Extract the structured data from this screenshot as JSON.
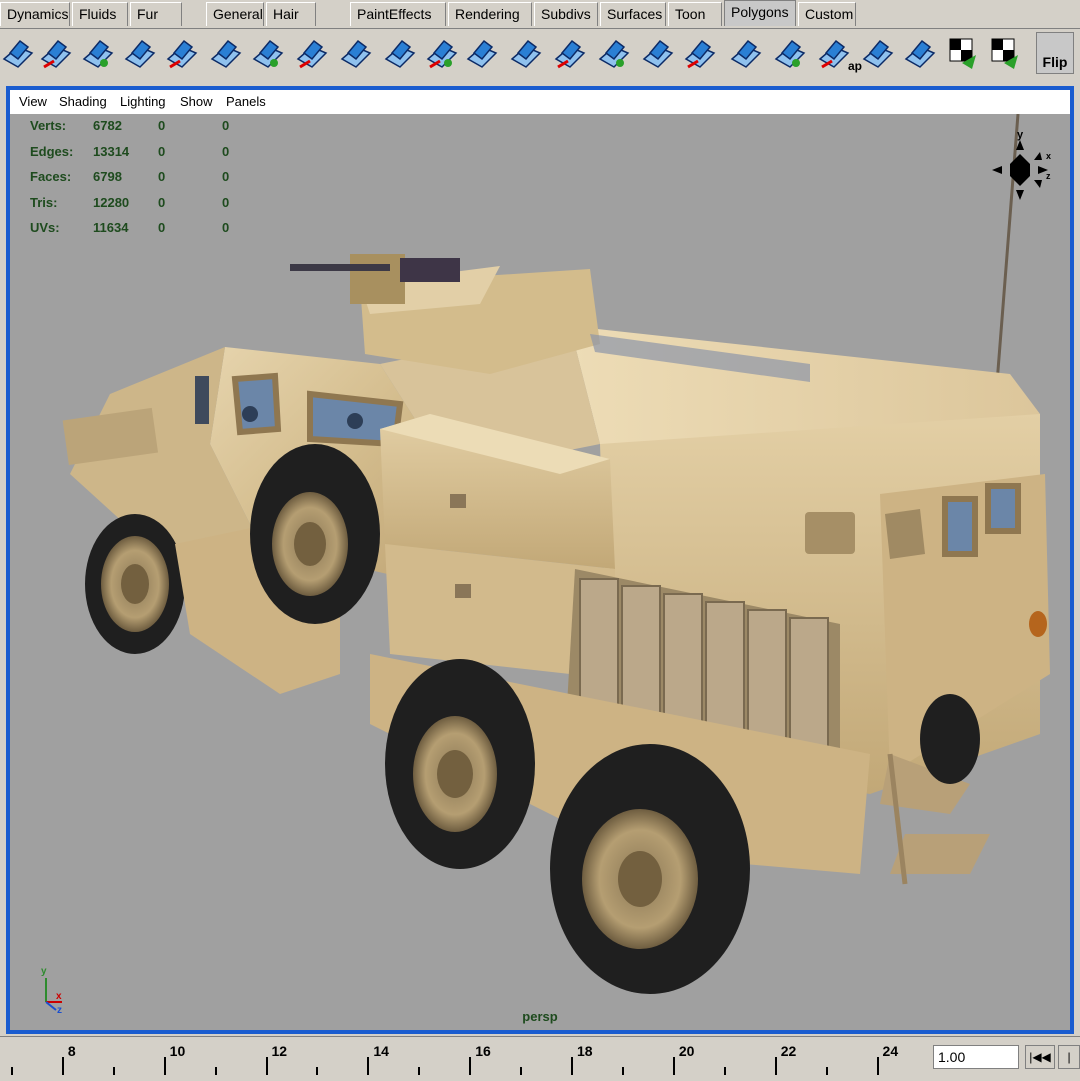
{
  "shelf_tabs": [
    {
      "label": "Dynamics"
    },
    {
      "label": "Fluids"
    },
    {
      "label": "Fur"
    },
    {
      "label": "General"
    },
    {
      "label": "Hair"
    },
    {
      "label": "PaintEffects"
    },
    {
      "label": "Rendering"
    },
    {
      "label": "Subdivs"
    },
    {
      "label": "Surfaces"
    },
    {
      "label": "Toon"
    },
    {
      "label": "Polygons",
      "active": true
    },
    {
      "label": "Custom"
    }
  ],
  "shelf_buttons": {
    "flip_label": "Flip",
    "partial_label": "ap"
  },
  "panel_menu": {
    "view": "View",
    "shading": "Shading",
    "lighting": "Lighting",
    "show": "Show",
    "panels": "Panels"
  },
  "hud": {
    "rows": [
      {
        "label": "Verts:",
        "total": "6782",
        "sel": "0",
        "comp": "0"
      },
      {
        "label": "Edges:",
        "total": "13314",
        "sel": "0",
        "comp": "0"
      },
      {
        "label": "Faces:",
        "total": "6798",
        "sel": "0",
        "comp": "0"
      },
      {
        "label": "Tris:",
        "total": "12280",
        "sel": "0",
        "comp": "0"
      },
      {
        "label": "UVs:",
        "total": "11634",
        "sel": "0",
        "comp": "0"
      }
    ]
  },
  "viewport": {
    "camera_label": "persp",
    "view_cube_axes": {
      "y": "y",
      "x": "x",
      "z": "z"
    },
    "gnomon_axes": {
      "y": "y",
      "x": "x",
      "z": "z"
    }
  },
  "colors": {
    "accent_border": "#1a5ccf",
    "viewport_bg": "#a0a0a0",
    "hud_text": "#1e4b1e",
    "vehicle_tan": "#d9c49a",
    "tire": "#1f1f1f"
  },
  "timeline": {
    "ticks": [
      "8",
      "10",
      "12",
      "14",
      "16",
      "18",
      "20",
      "22",
      "24"
    ],
    "current_frame": "1.00",
    "step_back_label": "|◀◀"
  }
}
